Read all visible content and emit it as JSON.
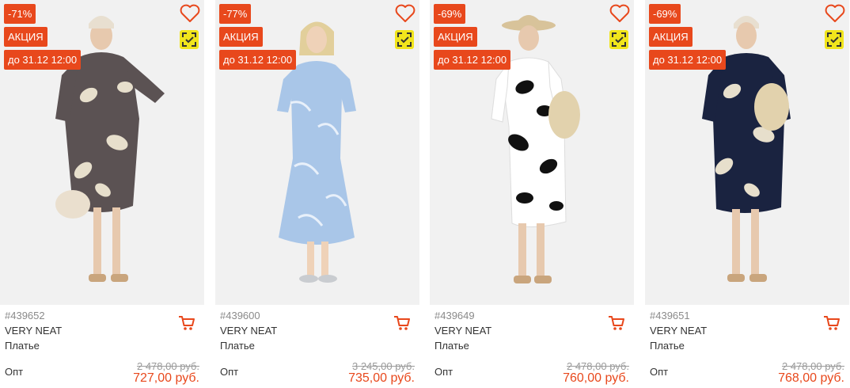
{
  "colors": {
    "accent": "#e8481c",
    "compare": "#f1e51c",
    "muted": "#8a8a8a"
  },
  "icons": {
    "favorite": "heart-icon",
    "compare": "compare-check-icon",
    "cart": "cart-icon"
  },
  "products": [
    {
      "discount": "-71%",
      "promo": "АКЦИЯ",
      "deadline": "до 31.12 12:00",
      "sku": "#439652",
      "brand": "VERY NEAT",
      "type": "Платье",
      "price_label": "Опт",
      "old_price": "2 478,00 руб.",
      "price": "727,00 руб."
    },
    {
      "discount": "-77%",
      "promo": "АКЦИЯ",
      "deadline": "до 31.12 12:00",
      "sku": "#439600",
      "brand": "VERY NEAT",
      "type": "Платье",
      "price_label": "Опт",
      "old_price": "3 245,00 руб.",
      "price": "735,00 руб."
    },
    {
      "discount": "-69%",
      "promo": "АКЦИЯ",
      "deadline": "до 31.12 12:00",
      "sku": "#439649",
      "brand": "VERY NEAT",
      "type": "Платье",
      "price_label": "Опт",
      "old_price": "2 478,00 руб.",
      "price": "760,00 руб."
    },
    {
      "discount": "-69%",
      "promo": "АКЦИЯ",
      "deadline": "до 31.12 12:00",
      "sku": "#439651",
      "brand": "VERY NEAT",
      "type": "Платье",
      "price_label": "Опт",
      "old_price": "2 478,00 руб.",
      "price": "768,00 руб."
    }
  ]
}
